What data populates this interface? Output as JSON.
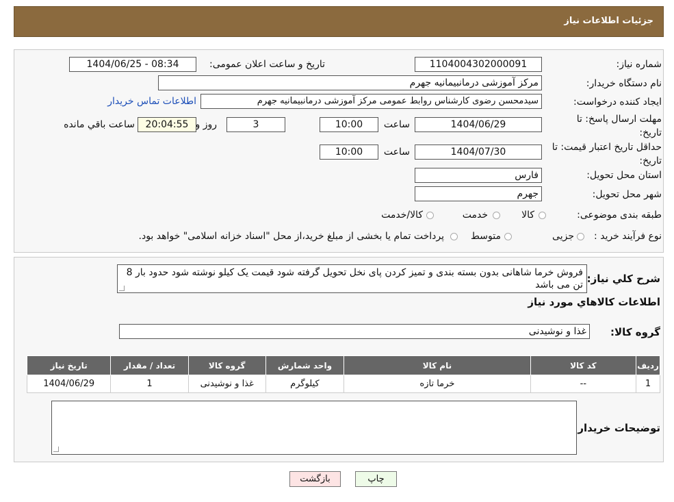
{
  "header": {
    "title": "جزئیات اطلاعات نیاز"
  },
  "form": {
    "need_number_label": "شماره نیاز:",
    "need_number": "1104004302000091",
    "announce_label": "تاریخ و ساعت اعلان عمومی:",
    "announce_value": "1404/06/25 - 08:34",
    "buyer_org_label": "نام دستگاه خریدار:",
    "buyer_org": "مرکز آموزشی درمانبیمانیه جهرم",
    "creator_label": "ایجاد کننده درخواست:",
    "creator": "سیدمحسن رضوی کارشناس روابط عمومی مرکز آموزشی درمانبیمانیه جهرم",
    "contact_link": "اطلاعات تماس خریدار",
    "deadline_label": "مهلت ارسال پاسخ: تا تاریخ:",
    "deadline_date": "1404/06/29",
    "time_label": "ساعت",
    "deadline_time": "10:00",
    "days": "3",
    "days_label": "روز و",
    "remaining": "20:04:55",
    "remaining_label": "ساعت باقي مانده",
    "price_validity_label": "حداقل تاریخ اعتبار قیمت: تا تاریخ:",
    "price_validity_date": "1404/07/30",
    "price_validity_time": "10:00",
    "province_label": "استان محل تحویل:",
    "province": "فارس",
    "city_label": "شهر محل تحویل:",
    "city": "جهرم",
    "category_label": "طبقه بندی موضوعی:",
    "category_options": [
      "کالا",
      "خدمت",
      "کالا/خدمت"
    ],
    "process_label": "نوع فرآیند خرید :",
    "process_options": [
      "جزیی",
      "متوسط"
    ],
    "process_note": "پرداخت تمام یا بخشی از مبلغ خرید،از محل \"اسناد خزانه اسلامی\" خواهد بود."
  },
  "description": {
    "label": "شرح كلي نياز:",
    "text": "فروش خرما شاهانی  بدون بسته بندی و تمیز کردن پای نخل  تحویل گرفته شود  قیمت یک کیلو نوشته شود  حدود بار 8 تن می باشد"
  },
  "goods": {
    "section_title": "اطلاعات كالاهاي مورد نياز",
    "group_label": "گروه کالا:",
    "group_value": "غذا و نوشیدنی",
    "columns": [
      "ردیف",
      "کد کالا",
      "نام کالا",
      "واحد شمارش",
      "گروه کالا",
      "تعداد / مقدار",
      "تاریخ نیاز"
    ],
    "rows": [
      [
        "1",
        "--",
        "خرما تازه",
        "کیلوگرم",
        "غذا و نوشیدنی",
        "1",
        "1404/06/29"
      ]
    ]
  },
  "buyer_notes": {
    "label": "توضیحات خریدار:",
    "value": ""
  },
  "buttons": {
    "print": "چاپ",
    "back": "بازگشت"
  },
  "colors": {
    "header_bg": "#8b6a3e",
    "table_header": "#666666",
    "link": "#1d4fb8"
  }
}
